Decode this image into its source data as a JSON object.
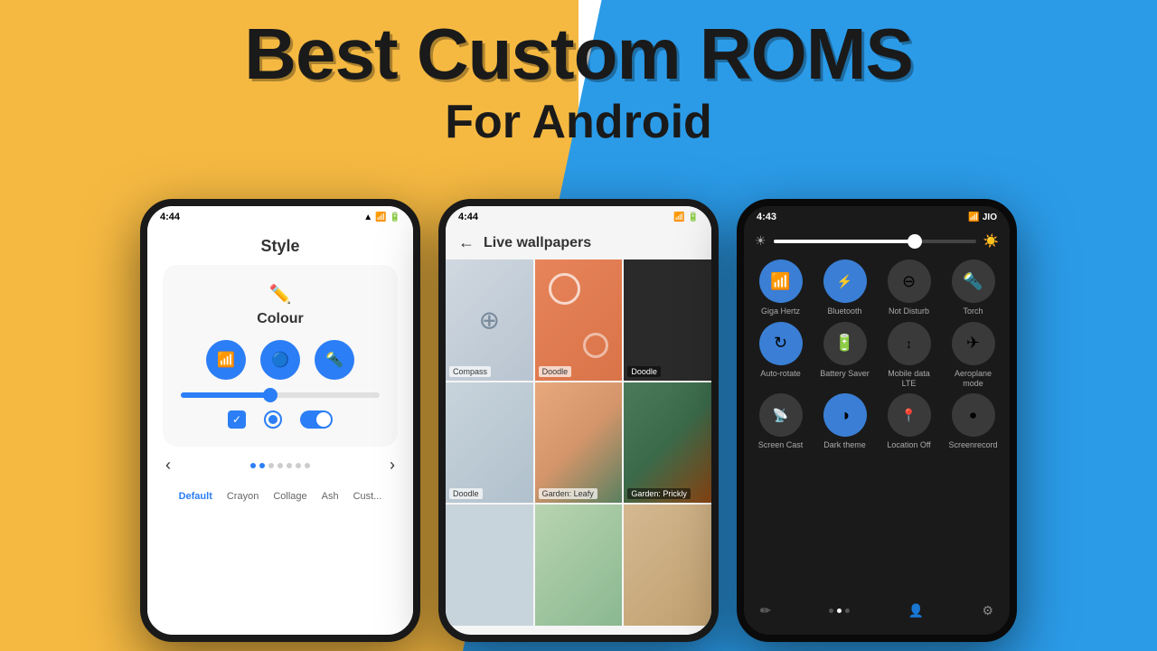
{
  "background": {
    "yellow": "#F5B942",
    "blue": "#2B9BE8"
  },
  "title": {
    "main": "Best Custom ROMS",
    "sub": "For Android"
  },
  "phone_left": {
    "status_time": "4:44",
    "screen_title": "Style",
    "colour_label": "Colour",
    "nav_labels": [
      "Default",
      "Crayon",
      "Collage",
      "Ash",
      "Cust..."
    ],
    "icon1": "wifi",
    "icon2": "bluetooth",
    "icon3": "flashlight"
  },
  "phone_middle": {
    "status_time": "4:44",
    "screen_title": "Live wallpapers",
    "wallpapers": [
      {
        "name": "Compass",
        "style": "compass"
      },
      {
        "name": "Doodle",
        "style": "doodle1"
      },
      {
        "name": "Doodle",
        "style": "doodle2"
      },
      {
        "name": "Doodle",
        "style": "doodle3"
      },
      {
        "name": "Garden: Leafy",
        "style": "garden1"
      },
      {
        "name": "Garden: Prickly",
        "style": "garden2"
      }
    ]
  },
  "phone_right": {
    "status_time": "4:43",
    "status_carrier": "JIO",
    "quick_tiles": [
      {
        "label": "Giga Hertz",
        "active": true,
        "icon": "📶"
      },
      {
        "label": "Bluetooth",
        "active": true,
        "icon": "🔵"
      },
      {
        "label": "Not Disturb",
        "active": false,
        "icon": "⊖"
      },
      {
        "label": "Torch",
        "active": false,
        "icon": "🔦"
      },
      {
        "label": "Auto-rotate",
        "active": true,
        "icon": "↻"
      },
      {
        "label": "Battery Saver",
        "active": false,
        "icon": "🔋"
      },
      {
        "label": "Mobile data LTE",
        "active": false,
        "icon": "↕"
      },
      {
        "label": "Aeroplane mode",
        "active": false,
        "icon": "✈"
      },
      {
        "label": "Screen Cast",
        "active": false,
        "icon": "📡"
      },
      {
        "label": "Dark theme",
        "active": true,
        "icon": "◑"
      },
      {
        "label": "Location Off",
        "active": false,
        "icon": "📍"
      },
      {
        "label": "Screenrecord",
        "active": false,
        "icon": "📱"
      }
    ]
  }
}
